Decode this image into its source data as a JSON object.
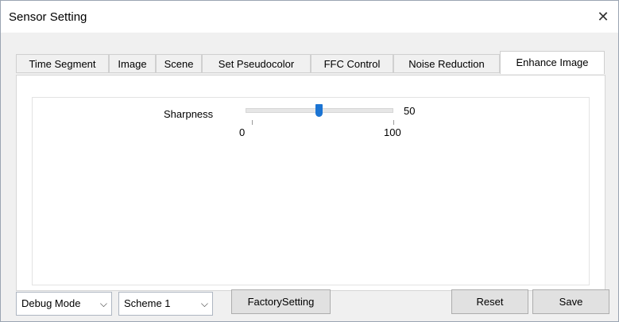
{
  "window": {
    "title": "Sensor Setting",
    "close_glyph": "✕"
  },
  "tabs": [
    {
      "label": "Time Segment"
    },
    {
      "label": "Image"
    },
    {
      "label": "Scene"
    },
    {
      "label": "Set Pseudocolor"
    },
    {
      "label": "FFC Control"
    },
    {
      "label": "Noise Reduction"
    },
    {
      "label": "Enhance Image",
      "active": true
    }
  ],
  "sharpness": {
    "label": "Sharpness",
    "value": "50",
    "min": "0",
    "max": "100"
  },
  "bottom": {
    "mode_select": "Debug Mode",
    "scheme_select": "Scheme 1",
    "factory_button": "FactorySetting",
    "reset_button": "Reset",
    "save_button": "Save",
    "dropdown_glyph": "⌵"
  },
  "colors": {
    "accent": "#1b74d3"
  }
}
